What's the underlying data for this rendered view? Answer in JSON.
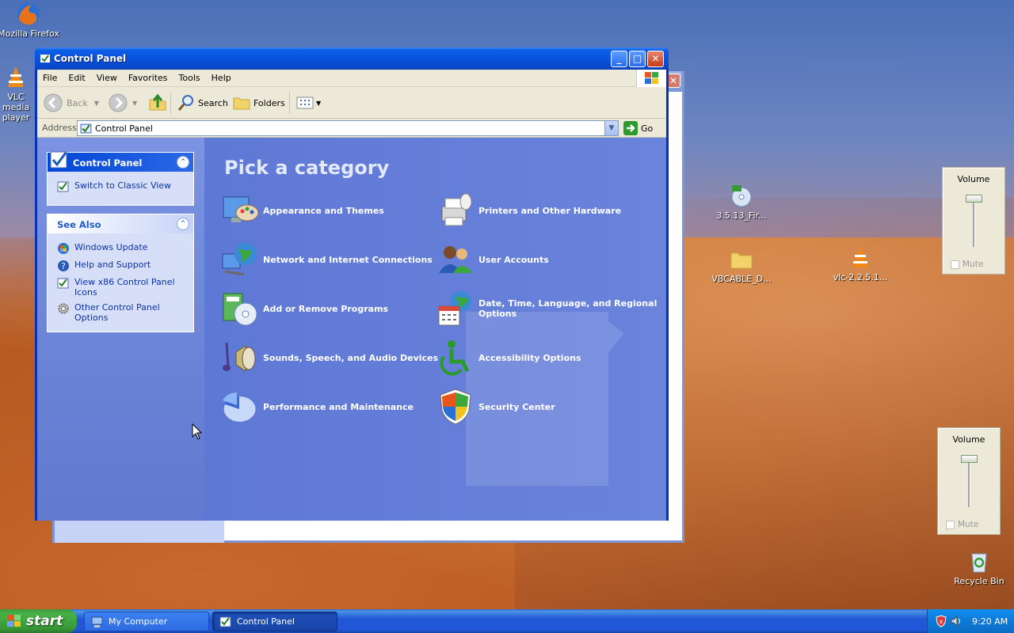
{
  "desktop": {
    "icons": [
      {
        "label": "Mozilla Firefox"
      },
      {
        "label": "VLC media player"
      },
      {
        "label": "3.5.13_Fir..."
      },
      {
        "label": "VBCABLE_D..."
      },
      {
        "label": "vlc-2.2.5.1..."
      },
      {
        "label": "Recycle Bin"
      }
    ]
  },
  "window": {
    "title": "Control Panel",
    "menu": [
      "File",
      "Edit",
      "View",
      "Favorites",
      "Tools",
      "Help"
    ],
    "toolbar": {
      "back": "Back",
      "search": "Search",
      "folders": "Folders"
    },
    "address": {
      "label": "Address",
      "value": "Control Panel",
      "go": "Go"
    },
    "tasks": {
      "control_panel": {
        "title": "Control Panel",
        "link": "Switch to Classic View"
      },
      "see_also": {
        "title": "See Also",
        "links": [
          "Windows Update",
          "Help and Support",
          "View x86 Control Panel Icons",
          "Other Control Panel Options"
        ]
      }
    },
    "heading": "Pick a category",
    "categories": [
      "Appearance and Themes",
      "Printers and Other Hardware",
      "Network and Internet Connections",
      "User Accounts",
      "Add or Remove Programs",
      "Date, Time, Language, and Regional Options",
      "Sounds, Speech, and Audio Devices",
      "Accessibility Options",
      "Performance and Maintenance",
      "Security Center"
    ]
  },
  "volume_widgets": [
    {
      "title": "Volume",
      "mute": "Mute"
    },
    {
      "title": "Volume",
      "mute": "Mute"
    }
  ],
  "taskbar": {
    "start": "start",
    "items": [
      "My Computer",
      "Control Panel"
    ],
    "clock": "9:20 AM"
  }
}
